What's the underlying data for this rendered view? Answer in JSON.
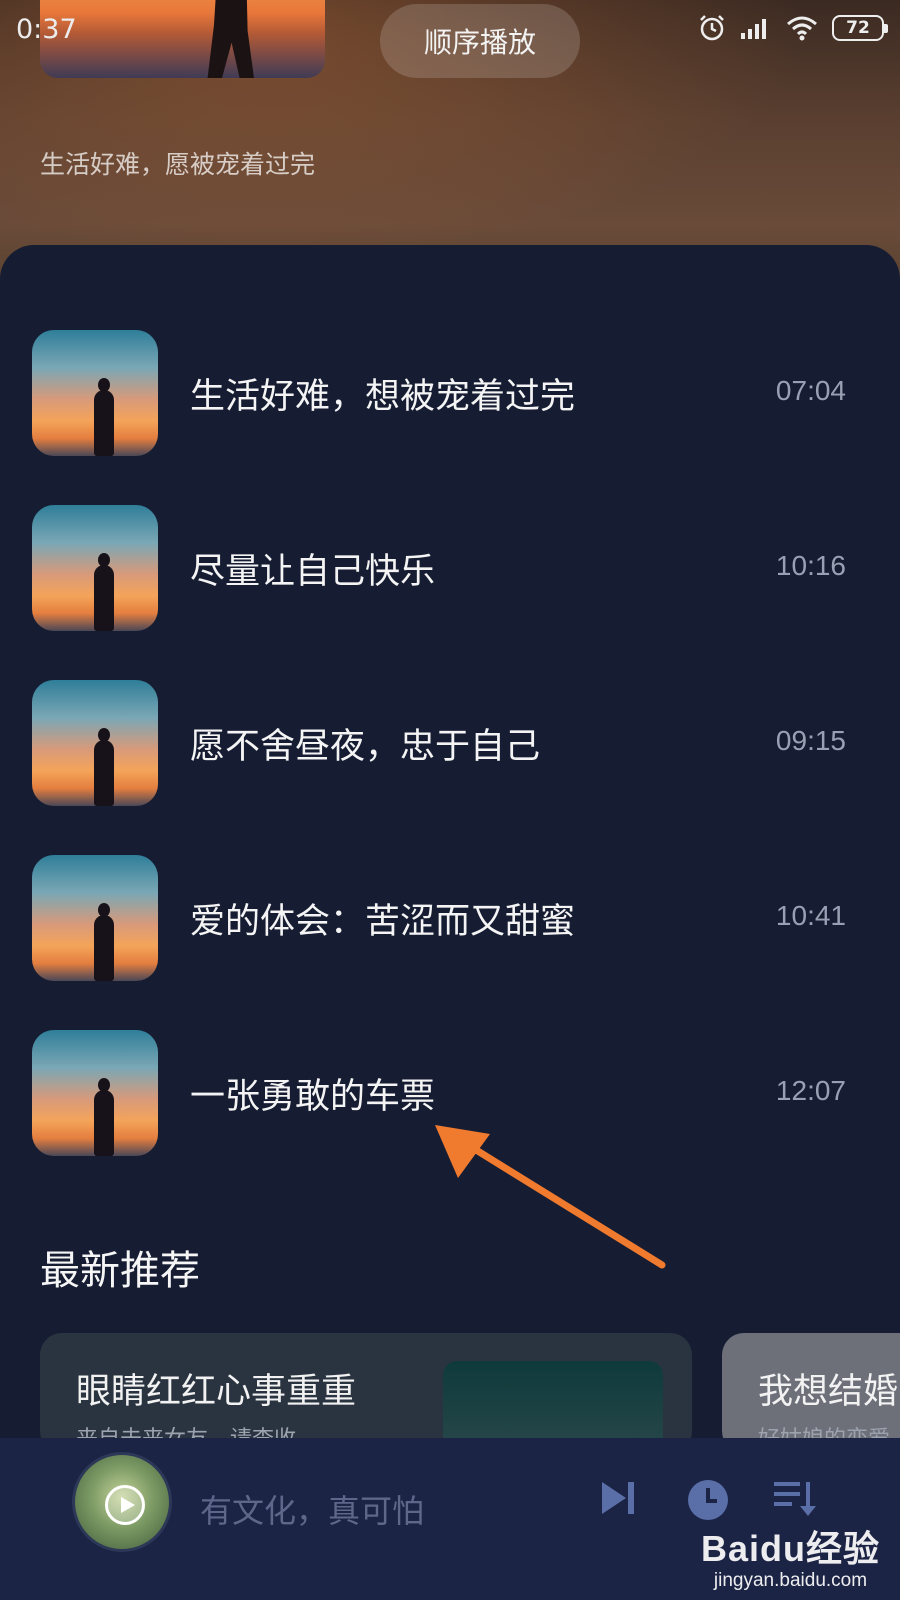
{
  "status_bar": {
    "time": "0:37",
    "battery": "72",
    "icons": [
      "alarm-icon",
      "signal-icon",
      "wifi-icon",
      "battery-icon"
    ]
  },
  "header": {
    "play_order_label": "顺序播放",
    "subtitle": "生活好难，愿被宠着过完"
  },
  "tracks": [
    {
      "title": "生活好难，想被宠着过完",
      "duration": "07:04"
    },
    {
      "title": "尽量让自己快乐",
      "duration": "10:16"
    },
    {
      "title": "愿不舍昼夜，忠于自己",
      "duration": "09:15"
    },
    {
      "title": "爱的体会：苦涩而又甜蜜",
      "duration": "10:41"
    },
    {
      "title": "一张勇敢的车票",
      "duration": "12:07"
    }
  ],
  "recommend": {
    "section_title": "最新推荐",
    "cards": [
      {
        "title": "眼睛红红心事重重",
        "subtitle": "来自未来女友，请查收"
      },
      {
        "title": "我想结婚",
        "subtitle": "好姑娘的恋爱"
      }
    ]
  },
  "player": {
    "now_playing": "有文化，真可怕",
    "controls": [
      "next-icon",
      "timer-icon",
      "playlist-icon"
    ]
  },
  "watermark": {
    "main": "Baidu经验",
    "sub": "jingyan.baidu.com"
  },
  "colors": {
    "background": "#161d33",
    "player_bar": "#1c2445",
    "annotation_arrow": "#f07a2e",
    "control_icons": "#5a6ea8"
  }
}
